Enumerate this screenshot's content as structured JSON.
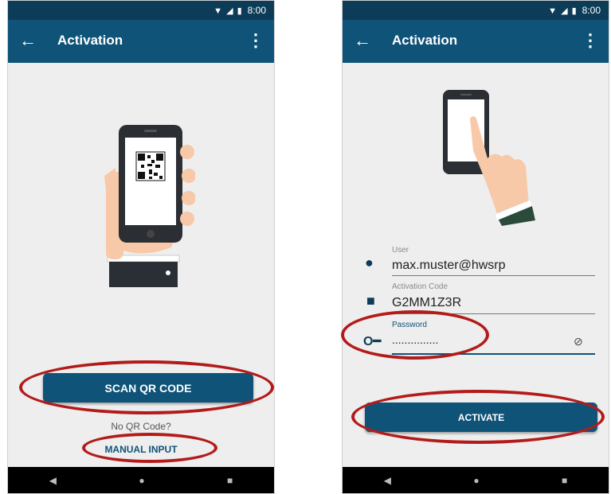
{
  "colors": {
    "appbar": "#0f5378",
    "statusbar": "#0c3c57",
    "highlight_ring": "#b31b1b",
    "button": "#0f5378"
  },
  "status_bar": {
    "time": "8:00",
    "network": "LTE"
  },
  "left_screen": {
    "title": "Activation",
    "scan_button_label": "SCAN QR CODE",
    "no_qr_text": "No QR Code?",
    "manual_input_label": "MANUAL INPUT"
  },
  "right_screen": {
    "title": "Activation",
    "fields": {
      "user": {
        "label": "User",
        "value": "max.muster@hwsrp",
        "icon": "person-icon"
      },
      "activation_code": {
        "label": "Activation Code",
        "value": "G2MM1Z3R",
        "icon": "lock-icon"
      },
      "password": {
        "label": "Password",
        "value": "...............",
        "icon": "key-icon"
      }
    },
    "activate_button_label": "ACTIVATE"
  },
  "nav": {
    "back_icon": "◀",
    "home_icon": "●",
    "recent_icon": "■"
  }
}
